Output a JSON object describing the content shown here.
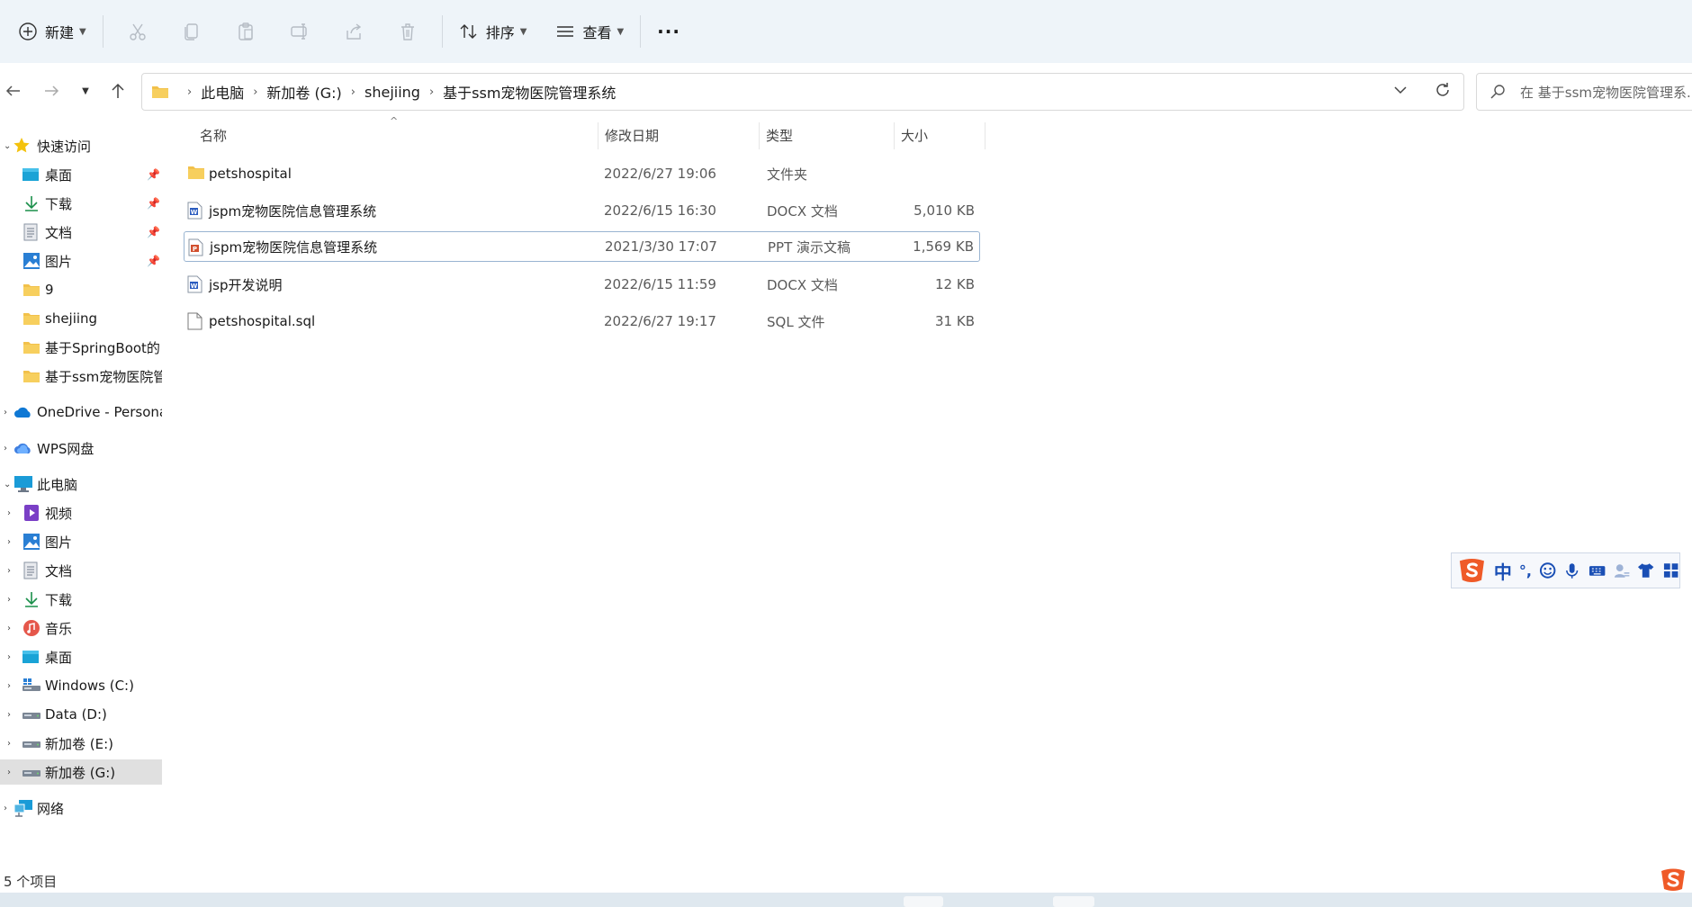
{
  "toolbar": {
    "new_label": "新建",
    "sort_label": "排序",
    "view_label": "查看",
    "more_label": "···"
  },
  "breadcrumb": [
    "此电脑",
    "新加卷 (G:)",
    "shejiing",
    "基于ssm宠物医院管理系统"
  ],
  "search": {
    "placeholder": "在 基于ssm宠物医院管理系..."
  },
  "sidebar": {
    "quick_access": "快速访问",
    "quick_items": [
      {
        "label": "桌面",
        "icon": "desktop-icon",
        "pinned": true
      },
      {
        "label": "下载",
        "icon": "download-icon",
        "pinned": true
      },
      {
        "label": "文档",
        "icon": "document-icon",
        "pinned": true
      },
      {
        "label": "图片",
        "icon": "pictures-icon",
        "pinned": true
      },
      {
        "label": "9",
        "icon": "folder-icon",
        "pinned": false
      },
      {
        "label": "shejiing",
        "icon": "folder-icon",
        "pinned": false
      },
      {
        "label": "基于SpringBoot的",
        "icon": "folder-icon",
        "pinned": false
      },
      {
        "label": "基于ssm宠物医院管",
        "icon": "folder-icon",
        "pinned": false
      }
    ],
    "onedrive": "OneDrive - Persona",
    "wps": "WPS网盘",
    "this_pc": "此电脑",
    "pc_items": [
      {
        "label": "视频",
        "icon": "video-icon"
      },
      {
        "label": "图片",
        "icon": "pictures-icon"
      },
      {
        "label": "文档",
        "icon": "document-icon"
      },
      {
        "label": "下载",
        "icon": "download-icon"
      },
      {
        "label": "音乐",
        "icon": "music-icon"
      },
      {
        "label": "桌面",
        "icon": "desktop-icon"
      },
      {
        "label": "Windows (C:)",
        "icon": "drive-icon"
      },
      {
        "label": "Data (D:)",
        "icon": "drive-icon"
      },
      {
        "label": "新加卷 (E:)",
        "icon": "drive-icon"
      },
      {
        "label": "新加卷 (G:)",
        "icon": "drive-icon"
      }
    ],
    "network": "网络"
  },
  "columns": {
    "name": "名称",
    "date": "修改日期",
    "type": "类型",
    "size": "大小"
  },
  "files": [
    {
      "name": "petshospital",
      "date": "2022/6/27 19:06",
      "type": "文件夹",
      "size": "",
      "icon": "folder-icon"
    },
    {
      "name": "jspm宠物医院信息管理系统",
      "date": "2022/6/15 16:30",
      "type": "DOCX 文档",
      "size": "5,010 KB",
      "icon": "word-doc-icon"
    },
    {
      "name": "jspm宠物医院信息管理系统",
      "date": "2021/3/30 17:07",
      "type": "PPT 演示文稿",
      "size": "1,569 KB",
      "icon": "ppt-icon"
    },
    {
      "name": "jsp开发说明",
      "date": "2022/6/15 11:59",
      "type": "DOCX 文档",
      "size": "12 KB",
      "icon": "word-doc-icon"
    },
    {
      "name": "petshospital.sql",
      "date": "2022/6/27 19:17",
      "type": "SQL 文件",
      "size": "31 KB",
      "icon": "file-icon"
    }
  ],
  "status": {
    "item_count": "5 个项目"
  },
  "ime": {
    "mode": "中",
    "punct": "°,"
  },
  "colors": {
    "toolbar_bg": "#eef4f9",
    "folder": "#f2c14b",
    "word": "#2b5cbf",
    "ppt": "#d2502f",
    "sogou": "#ef5a28"
  }
}
